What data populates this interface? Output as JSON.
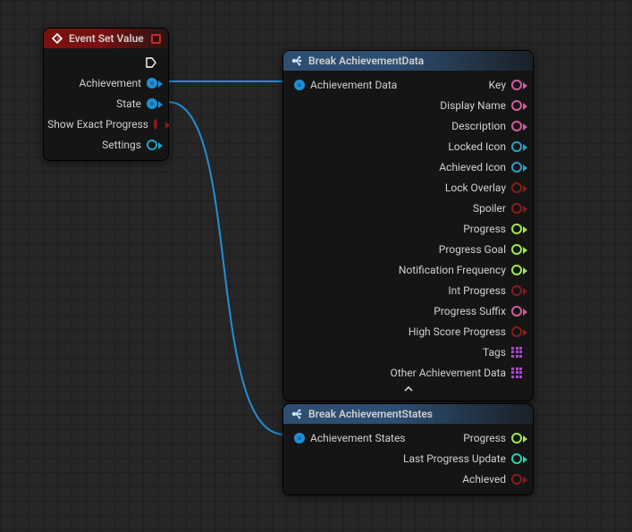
{
  "nodes": {
    "event": {
      "title": "Event Set Value",
      "pins": {
        "achievement": "Achievement",
        "state": "State",
        "show_exact_progress": "Show Exact Progress",
        "settings": "Settings"
      }
    },
    "break_data": {
      "title": "Break AchievementData",
      "input": "Achievement Data",
      "outputs": {
        "key": "Key",
        "display_name": "Display Name",
        "description": "Description",
        "locked_icon": "Locked Icon",
        "achieved_icon": "Achieved Icon",
        "lock_overlay": "Lock Overlay",
        "spoiler": "Spoiler",
        "progress": "Progress",
        "progress_goal": "Progress Goal",
        "notification_frequency": "Notification Frequency",
        "int_progress": "Int Progress",
        "progress_suffix": "Progress Suffix",
        "high_score_progress": "High Score Progress",
        "tags": "Tags",
        "other_data": "Other Achievement Data"
      }
    },
    "break_states": {
      "title": "Break AchievementStates",
      "input": "Achievement States",
      "outputs": {
        "progress": "Progress",
        "last_progress_update": "Last Progress Update",
        "achieved": "Achieved"
      }
    }
  }
}
